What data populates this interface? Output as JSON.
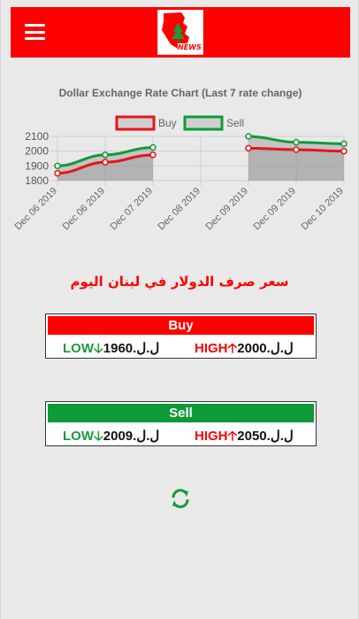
{
  "header": {
    "logo_text": "NEWS"
  },
  "chart_data": {
    "type": "line",
    "title": "Dollar Exchange Rate Chart (Last 7 rate change)",
    "categories": [
      "Dec 06 2019",
      "Dec 06 2019",
      "Dec 07 2019",
      "Dec 08 2019",
      "Dec 09 2019",
      "Dec 09 2019",
      "Dec 10 2019"
    ],
    "ylim": [
      1800,
      2100
    ],
    "yticks": [
      "2100",
      "2000",
      "1900",
      "1800"
    ],
    "legend_position": "top",
    "series": [
      {
        "name": "Buy",
        "color": "#e8141c",
        "values": [
          1850,
          1925,
          1975,
          null,
          2020,
          2010,
          2000
        ]
      },
      {
        "name": "Sell",
        "color": "#0f9a3a",
        "values": [
          1900,
          1975,
          2025,
          null,
          2100,
          2060,
          2050
        ]
      }
    ]
  },
  "arabic_title": "سعر صرف الدولار في لبنان اليوم",
  "buy": {
    "label": "Buy",
    "low_label": "LOW",
    "low_value": "1960.ل.ل",
    "high_label": "HIGH",
    "high_value": "2000.ل.ل",
    "color": "#ff0000"
  },
  "sell": {
    "label": "Sell",
    "low_label": "LOW",
    "low_value": "2009.ل.ل",
    "high_label": "HIGH",
    "high_value": "2050.ل.ل",
    "color": "#0f9a3a"
  },
  "icons": {
    "low": "arrow-down-icon",
    "high": "arrow-up-icon",
    "refresh": "refresh-icon",
    "menu": "hamburger-menu-icon"
  }
}
